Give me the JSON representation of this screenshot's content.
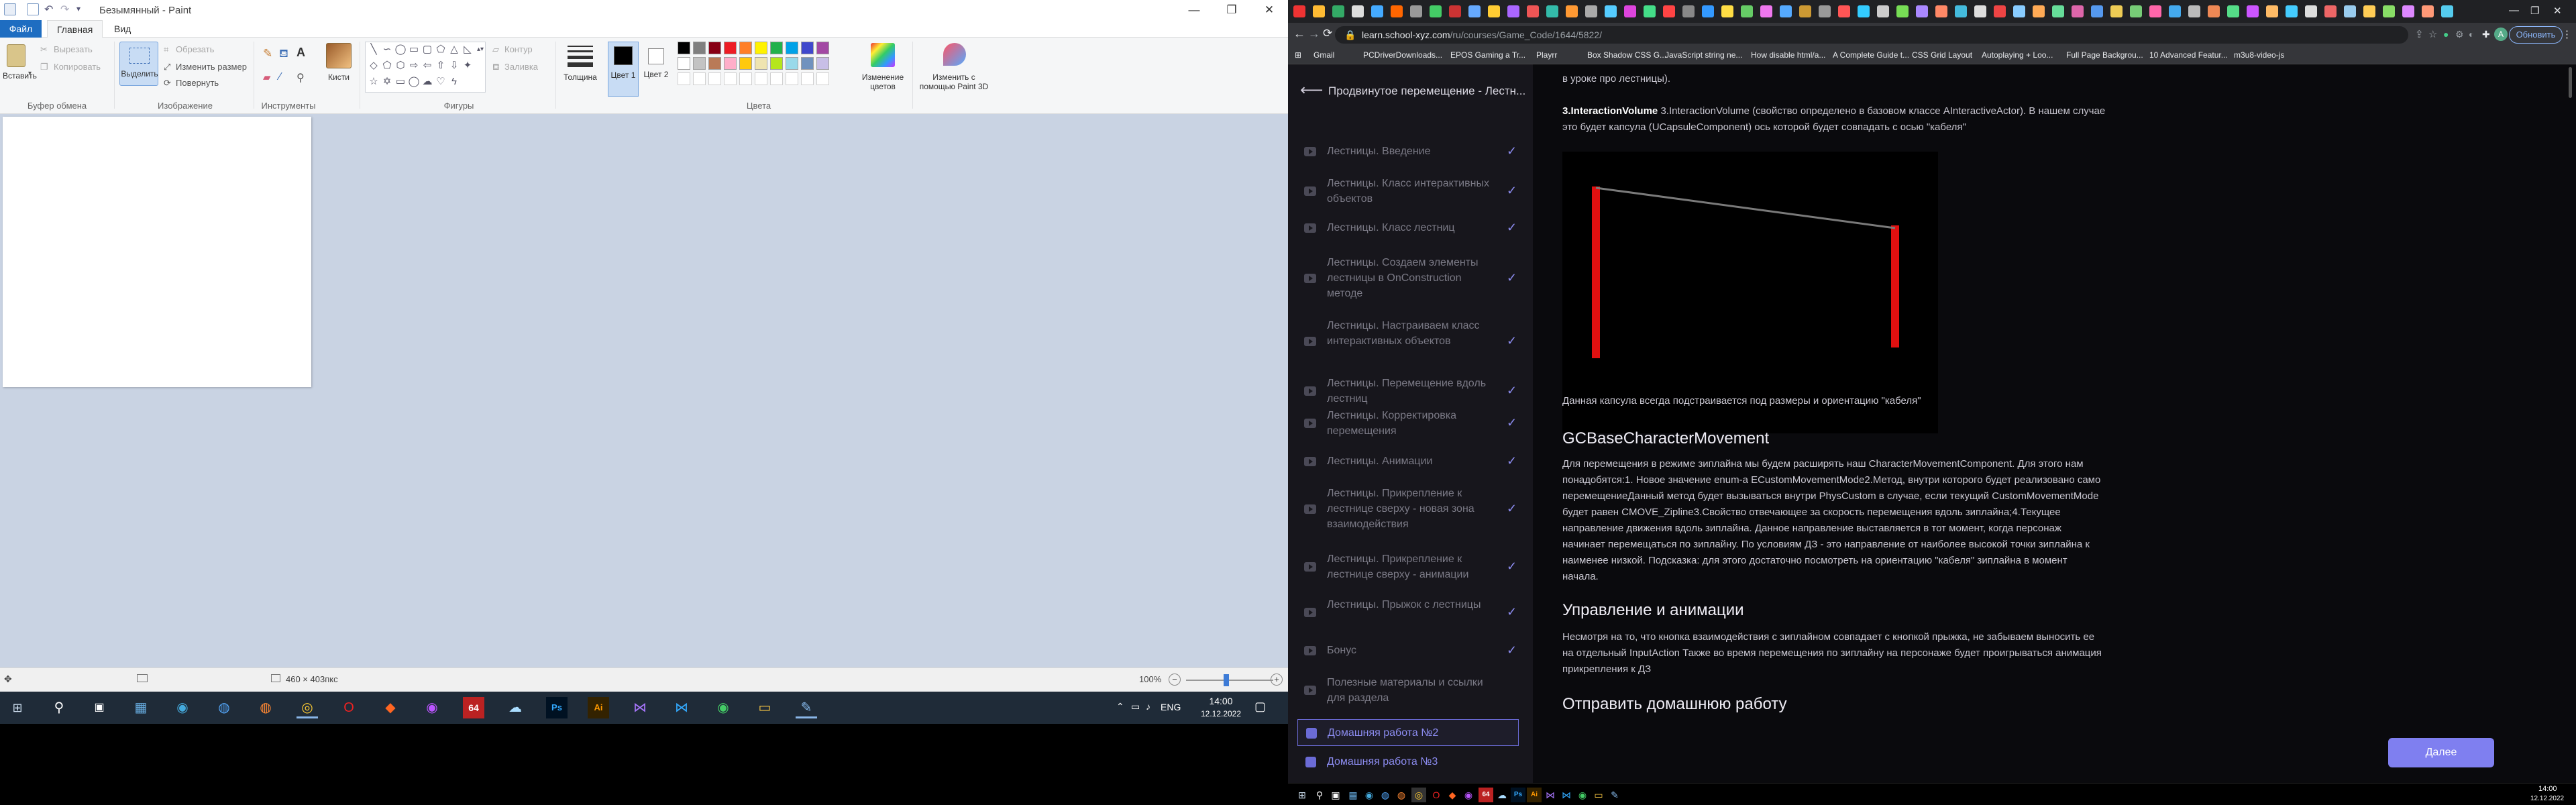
{
  "paint": {
    "window_title": "Безымянный - Paint",
    "tabs": [
      "Файл",
      "Главная",
      "Вид"
    ],
    "clipboard": {
      "paste": "Вставить",
      "cut": "Вырезать",
      "copy": "Копировать",
      "label": "Буфер обмена"
    },
    "image": {
      "select": "Выделить",
      "crop": "Обрезать",
      "resize": "Изменить размер",
      "rotate": "Повернуть",
      "label": "Изображение"
    },
    "tools": {
      "label": "Инструменты"
    },
    "brushes": "Кисти",
    "shapes": {
      "outline": "Контур",
      "fill": "Заливка",
      "label": "Фигуры"
    },
    "size": "Толщина",
    "color1": "Цвет 1",
    "color2": "Цвет 2",
    "colors_label": "Цвета",
    "edit_colors": "Изменение цветов",
    "paint3d": "Изменить с помощью Paint 3D",
    "palette": [
      "#000000",
      "#7f7f7f",
      "#880015",
      "#ed1c24",
      "#ff7f27",
      "#fff200",
      "#22b14c",
      "#00a2e8",
      "#3f48cc",
      "#a349a4",
      "#ffffff",
      "#c3c3c3",
      "#b97a57",
      "#ffaec9",
      "#ffc90e",
      "#efe4b0",
      "#b5e61d",
      "#99d9ea",
      "#7092be",
      "#c8bfe7"
    ],
    "status": {
      "dimensions": "460 × 403пкс",
      "zoom": "100%"
    },
    "clock": {
      "time": "14:00",
      "date": "12.12.2022"
    },
    "lang": "ENG"
  },
  "browser": {
    "url_host": "learn.school-xyz.com",
    "url_path": "/ru/courses/Game_Code/1644/5822/",
    "update_button": "Обновить",
    "bookmarks": [
      "Gmail",
      "PCDriverDownloads...",
      "EPOS Gaming a Tr...",
      "Playrr",
      "Box Shadow CSS G...",
      "JavaScript string ne...",
      "How disable html/a...",
      "A Complete Guide t...",
      "CSS Grid Layout",
      "Autoplaying + Loo...",
      "Full Page Backgrou...",
      "10 Advanced Featur...",
      "m3u8-video-js"
    ],
    "sidebar": {
      "title": "Продвинутое перемещение - Лестн...",
      "lessons": [
        "Лестницы. Введение",
        "Лестницы. Класс интерактивных объектов",
        "Лестницы. Класс лестниц",
        "Лестницы. Создаем элементы лестницы в OnConstruction методе",
        "Лестницы. Настраиваем класс интерактивных объектов",
        "Лестницы. Перемещение вдоль лестниц",
        "Лестницы. Корректировка перемещения",
        "Лестницы. Анимации",
        "Лестницы. Прикрепление к лестнице сверху - новая зона взаимодействия",
        "Лестницы. Прикрепление к лестнице сверху - анимации",
        "Лестницы. Прыжок с лестницы",
        "Бонус",
        "Полезные материалы и ссылки для раздела"
      ],
      "homework": [
        "Домашняя работа №2",
        "Домашняя работа №3"
      ]
    },
    "content": {
      "top_line": "в уроке про лестницы).",
      "p1": "3.InteractionVolume (свойство определено в базовом классе AInteractiveActor). В нашем случае это будет капсула (UCapsuleComponent) ось которой будет совпадать с осью \"кабеля\"",
      "p2": "Данная капсула всегда подстраивается под размеры и ориентацию \"кабеля\"",
      "h1": "GCBaseCharacterMovement",
      "p3": "Для перемещения в режиме зиплайна мы будем расширять наш CharacterMovementComponent. Для этого нам понадобятся:1. Новое значение enum-а ECustomMovementMode2.Метод, внутри которого будет реализовано само перемещениеДанный метод будет вызываться внутри PhysCustom в случае, если текущий CustomMovementMode будет равен CMOVE_Zipline3.Свойство отвечающее за скорость перемещения вдоль зиплайна;4.Текущее направление движения вдоль зиплайна. Данное направление выставляется в тот момент, когда персонаж начинает перемещаться по зиплайну. По условиям ДЗ - это направление от наиболее высокой точки зиплайна к наименее низкой. Подсказка: для этого достаточно посмотреть на ориентацию \"кабеля\" зиплайна в момент начала.",
      "h2": "Управление и анимации",
      "p4": "Несмотря на то, что кнопка взаимодействия с зиплайном совпадает с кнопкой прыжка, не забываем выносить ее на отдельный InputAction Также во время перемещения по зиплайну на персонаже будет проигрываться анимация прикрепления к ДЗ",
      "h3": "Отправить домашнюю работу",
      "next": "Далее"
    },
    "clock": {
      "time": "14:00",
      "date": "12.12.2022"
    }
  }
}
